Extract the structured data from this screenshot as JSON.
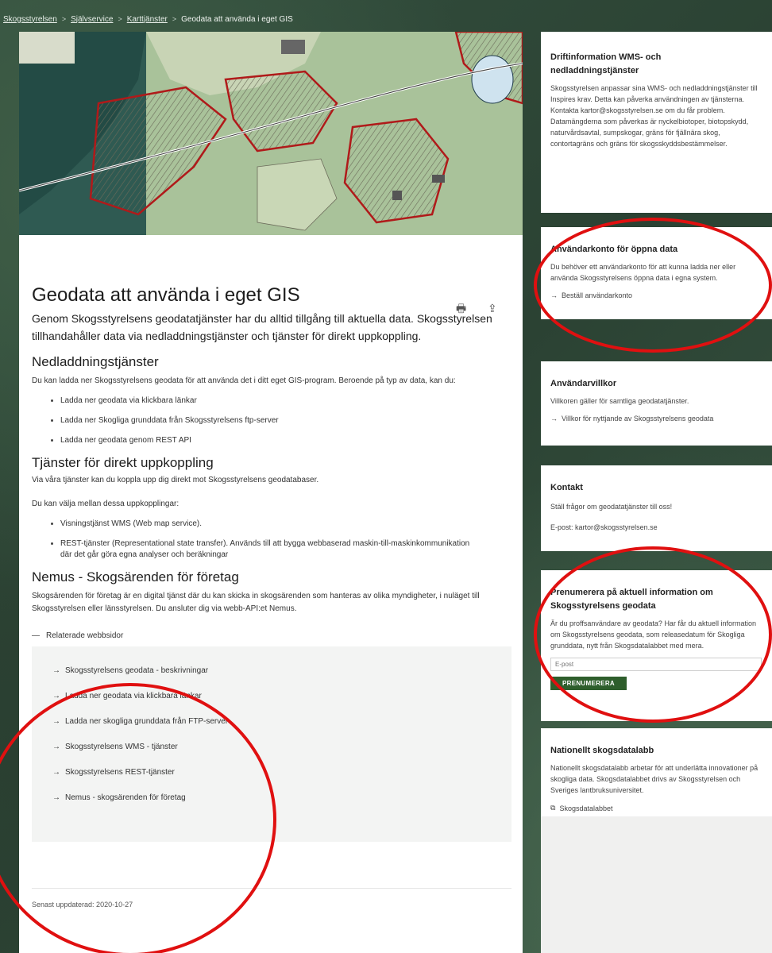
{
  "breadcrumb": {
    "items": [
      "Skogsstyrelsen",
      "Självservice",
      "Karttjänster"
    ],
    "current": "Geodata att använda i eget GIS",
    "separator": ">"
  },
  "tools": {
    "print_icon": "print-icon",
    "share_icon": "share-icon",
    "print_glyph": "🖶",
    "share_glyph": "⇪"
  },
  "main": {
    "title": "Geodata att använda i eget GIS",
    "lead": "Genom Skogsstyrelsens geodatatjänster har du alltid tillgång till aktuella data. Skogsstyrelsen tillhandahåller data via nedladdningstjänster och tjänster för direkt uppkoppling.",
    "sections": {
      "download": {
        "heading": "Nedladdningstjänster",
        "body": "Du kan ladda ner Skogsstyrelsens geodata för att använda det i ditt eget GIS-program. Beroende på typ av data, kan du:",
        "bullets": [
          "Ladda ner geodata via klickbara länkar",
          "Ladda ner Skogliga grunddata från Skogsstyrelsens ftp-server",
          "Ladda ner geodata genom REST API"
        ]
      },
      "direct": {
        "heading": "Tjänster för direkt uppkoppling",
        "body1": "Via våra tjänster kan du koppla upp dig direkt mot Skogsstyrelsens geodatabaser.",
        "body2": "Du kan välja mellan dessa uppkopplingar:",
        "bullets": [
          "Visningstjänst WMS (Web map service).",
          "REST-tjänster (Representational state transfer). Används till att bygga webbaserad maskin-till-maskinkommunikation där det går göra egna analyser och beräkningar"
        ]
      },
      "nemus": {
        "heading": "Nemus - Skogsärenden för företag",
        "body": "Skogsärenden för företag är en digital tjänst där du kan skicka in skogsärenden som hanteras av olika myndigheter, i nuläget till Skogsstyrelsen eller länsstyrelsen. Du ansluter dig via webb-API:et Nemus."
      }
    },
    "related": {
      "toggle_symbol": "—",
      "toggle_label": "Relaterade webbsidor",
      "links": [
        "Skogsstyrelsens geodata - beskrivningar",
        "Ladda ner geodata via klickbara länkar",
        "Ladda ner skogliga grunddata från FTP-server",
        "Skogsstyrelsens WMS - tjänster",
        "Skogsstyrelsens REST-tjänster",
        "Nemus - skogsärenden för företag"
      ]
    },
    "updated": "Senast uppdaterad: 2020-10-27"
  },
  "sidebar": {
    "drift": {
      "title": "Driftinformation WMS- och nedladdningstjänster",
      "body": "Skogsstyrelsen anpassar sina WMS- och nedladdningstjänster till Inspires krav. Detta kan påverka användningen av tjänsterna. Kontakta kartor@skogsstyrelsen.se om du får problem. Datamängderna som påverkas är nyckelbiotoper, biotopskydd, naturvårdsavtal, sumpskogar, gräns för fjällnära skog, contortagräns och gräns för skogsskyddsbestämmelser."
    },
    "account": {
      "title": "Användarkonto för öppna data",
      "body": "Du behöver ett användarkonto för att kunna ladda ner eller använda Skogsstyrelsens öppna data i egna system.",
      "link": "Beställ användarkonto"
    },
    "terms": {
      "title": "Användarvillkor",
      "body": "Villkoren gäller för samtliga geodatatjänster.",
      "link": "Villkor för nyttjande av Skogsstyrelsens geodata"
    },
    "contact": {
      "title": "Kontakt",
      "body": "Ställ frågor om geodatatjänster till oss!",
      "email": "E-post: kartor@skogsstyrelsen.se"
    },
    "subscribe": {
      "title": "Prenumerera på aktuell information om Skogsstyrelsens geodata",
      "body": "Är du proffsanvändare av geodata? Har får du aktuell information om Skogsstyrelsens geodata, som releasedatum för Skogliga grunddata, nytt från Skogsdatalabbet med mera.",
      "placeholder": "E-post",
      "button": "PRENUMERERA"
    },
    "lab": {
      "title": "Nationellt skogsdatalabb",
      "body": "Nationellt skogsdatalabb arbetar för att underlätta innovationer på skogliga data. Skogsdatalabbet drivs av Skogsstyrelsen och Sveriges lantbruksuniversitet.",
      "link": "Skogsdatalabbet"
    }
  },
  "glyphs": {
    "arrow": "→",
    "external": "⧉"
  },
  "colors": {
    "annotation_red": "#e01010",
    "button_green": "#2e5e2c"
  }
}
